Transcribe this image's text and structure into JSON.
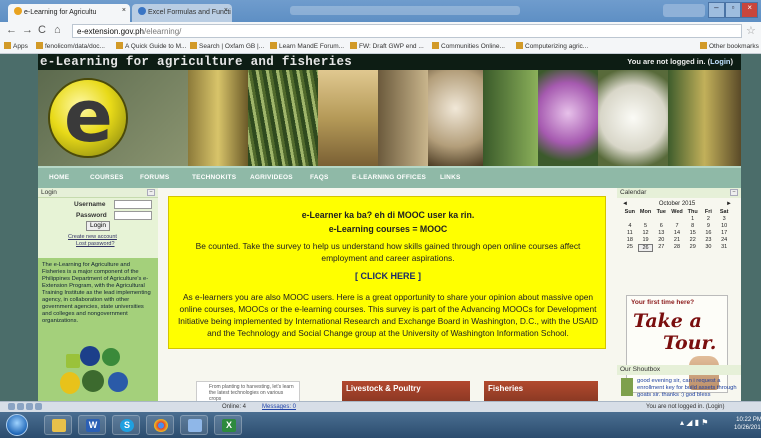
{
  "browser": {
    "tabs": [
      {
        "label": "e-Learning for Agricultu"
      },
      {
        "label": "Excel Formulas and Functi"
      }
    ],
    "url_host": "e-extension.gov.ph",
    "url_path": "/elearning/",
    "bookmarks": [
      "Apps",
      "fenolicom/data/doc...",
      "A Quick Guide to M...",
      "Search | Oxfam GB |...",
      "Learn MandE Forum...",
      "FW: Draft GWP end ...",
      "Communities Online...",
      "Computerizing agric...",
      "Other bookmarks"
    ]
  },
  "site": {
    "title": "e-Learning for agriculture and fisheries",
    "login_status": "You are not logged in. (",
    "login_link": "Login",
    "login_status_end": ")",
    "logo_letter": "e"
  },
  "nav": [
    "HOME",
    "COURSES",
    "FORUMS",
    "TECHNOKITS",
    "AGRIVIDEOS",
    "FAQS",
    "E-LEARNING OFFICES",
    "LINKS"
  ],
  "login_block": {
    "title": "Login",
    "username_label": "Username",
    "password_label": "Password",
    "button": "Login",
    "create_account": "Create new account",
    "lost_password": "Lost password?"
  },
  "about_text": "The e-Learning for Agriculture and Fisheries is a major component of the Philippines Department of Agriculture's e-Extension Program, with the Agricultural Training Institute as the lead implementing agency, in collaboration with other government agencies, state universities and colleges and nongovernment organizations.",
  "notice": {
    "line1": "e-Learner ka ba? eh di MOOC user ka rin.",
    "line2": "e-Learning courses = MOOC",
    "para1": "Be counted. Take the survey to help us understand how skills gained through open online courses affect employment and career aspirations.",
    "cta": "[ CLICK HERE ]",
    "para2": "As e-learners you are also MOOC users.  Here is a great opportunity to share your opinion about massive open online courses, MOOCs or the e-learning courses.  This survey is part of the Advancing MOOCs for Development Initiative being implemented by International Research and Exchange Board in Washington, D.C., with the USAID and the Technology and Social Change group at the University of Washington Information School."
  },
  "tiles": {
    "image_alt": "From planting to harvesting, let's learn the latest technologies on various crops",
    "livestock": "Livestock & Poultry",
    "fisheries": "Fisheries"
  },
  "calendar": {
    "title": "Calendar",
    "month": "October 2015",
    "prev": "◄",
    "next": "►",
    "days": [
      "Sun",
      "Mon",
      "Tue",
      "Wed",
      "Thu",
      "Fri",
      "Sat"
    ],
    "cells": [
      "",
      "",
      "",
      "",
      "1",
      "2",
      "3",
      "4",
      "5",
      "6",
      "7",
      "8",
      "9",
      "10",
      "11",
      "12",
      "13",
      "14",
      "15",
      "16",
      "17",
      "18",
      "19",
      "20",
      "21",
      "22",
      "23",
      "24",
      "25",
      "26",
      "27",
      "28",
      "29",
      "30",
      "31"
    ],
    "today": "26"
  },
  "tour": {
    "question": "Your first time here?",
    "word1": "Take a",
    "word2": "Tour."
  },
  "shoutbox": {
    "title": "Our Shoutbox",
    "message": "good evening sir, can i request a enrollment key for build assets through goats sir. thanks :) god bless"
  },
  "status": {
    "online": "Online: 4",
    "messages": "Messages: 0",
    "footer_login": "You are not logged in. (Login)"
  },
  "taskbar": {
    "time": "10:22 PM",
    "date": "10/26/2015"
  }
}
